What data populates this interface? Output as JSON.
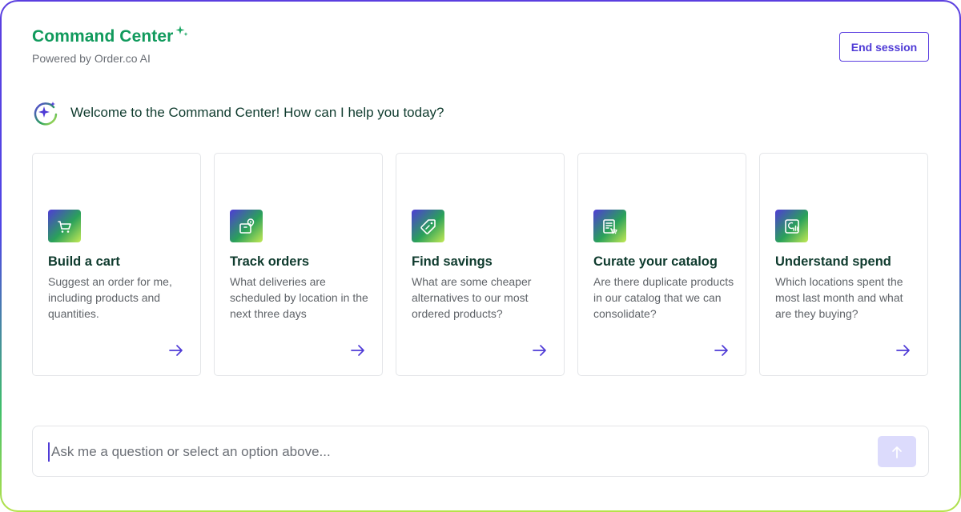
{
  "header": {
    "title": "Command Center",
    "subtitle": "Powered by Order.co AI",
    "end_session_label": "End session"
  },
  "welcome": {
    "message": "Welcome to the Command Center! How can I help you today?",
    "icon": "sparkle-circle-icon"
  },
  "cards": [
    {
      "title": "Build a cart",
      "description": "Suggest an order for me, including products and quantities.",
      "icon": "cart-icon"
    },
    {
      "title": "Track orders",
      "description": "What deliveries are scheduled by location in the next three days",
      "icon": "package-location-icon"
    },
    {
      "title": "Find savings",
      "description": "What are some cheaper alternatives to our most ordered products?",
      "icon": "price-tag-icon"
    },
    {
      "title": "Curate your catalog",
      "description": "Are there duplicate products in our catalog that we can consolidate?",
      "icon": "catalog-cart-icon"
    },
    {
      "title": "Understand spend",
      "description": "Which locations spent the most last month and what are they buying?",
      "icon": "spend-chart-icon"
    }
  ],
  "input": {
    "placeholder": "Ask me a question or select an option above...",
    "value": ""
  },
  "colors": {
    "brand_green": "#109a5c",
    "accent_purple": "#4f3bd6",
    "heading_dark": "#0f3b2e",
    "send_button_disabled": "#dcdbfc"
  }
}
